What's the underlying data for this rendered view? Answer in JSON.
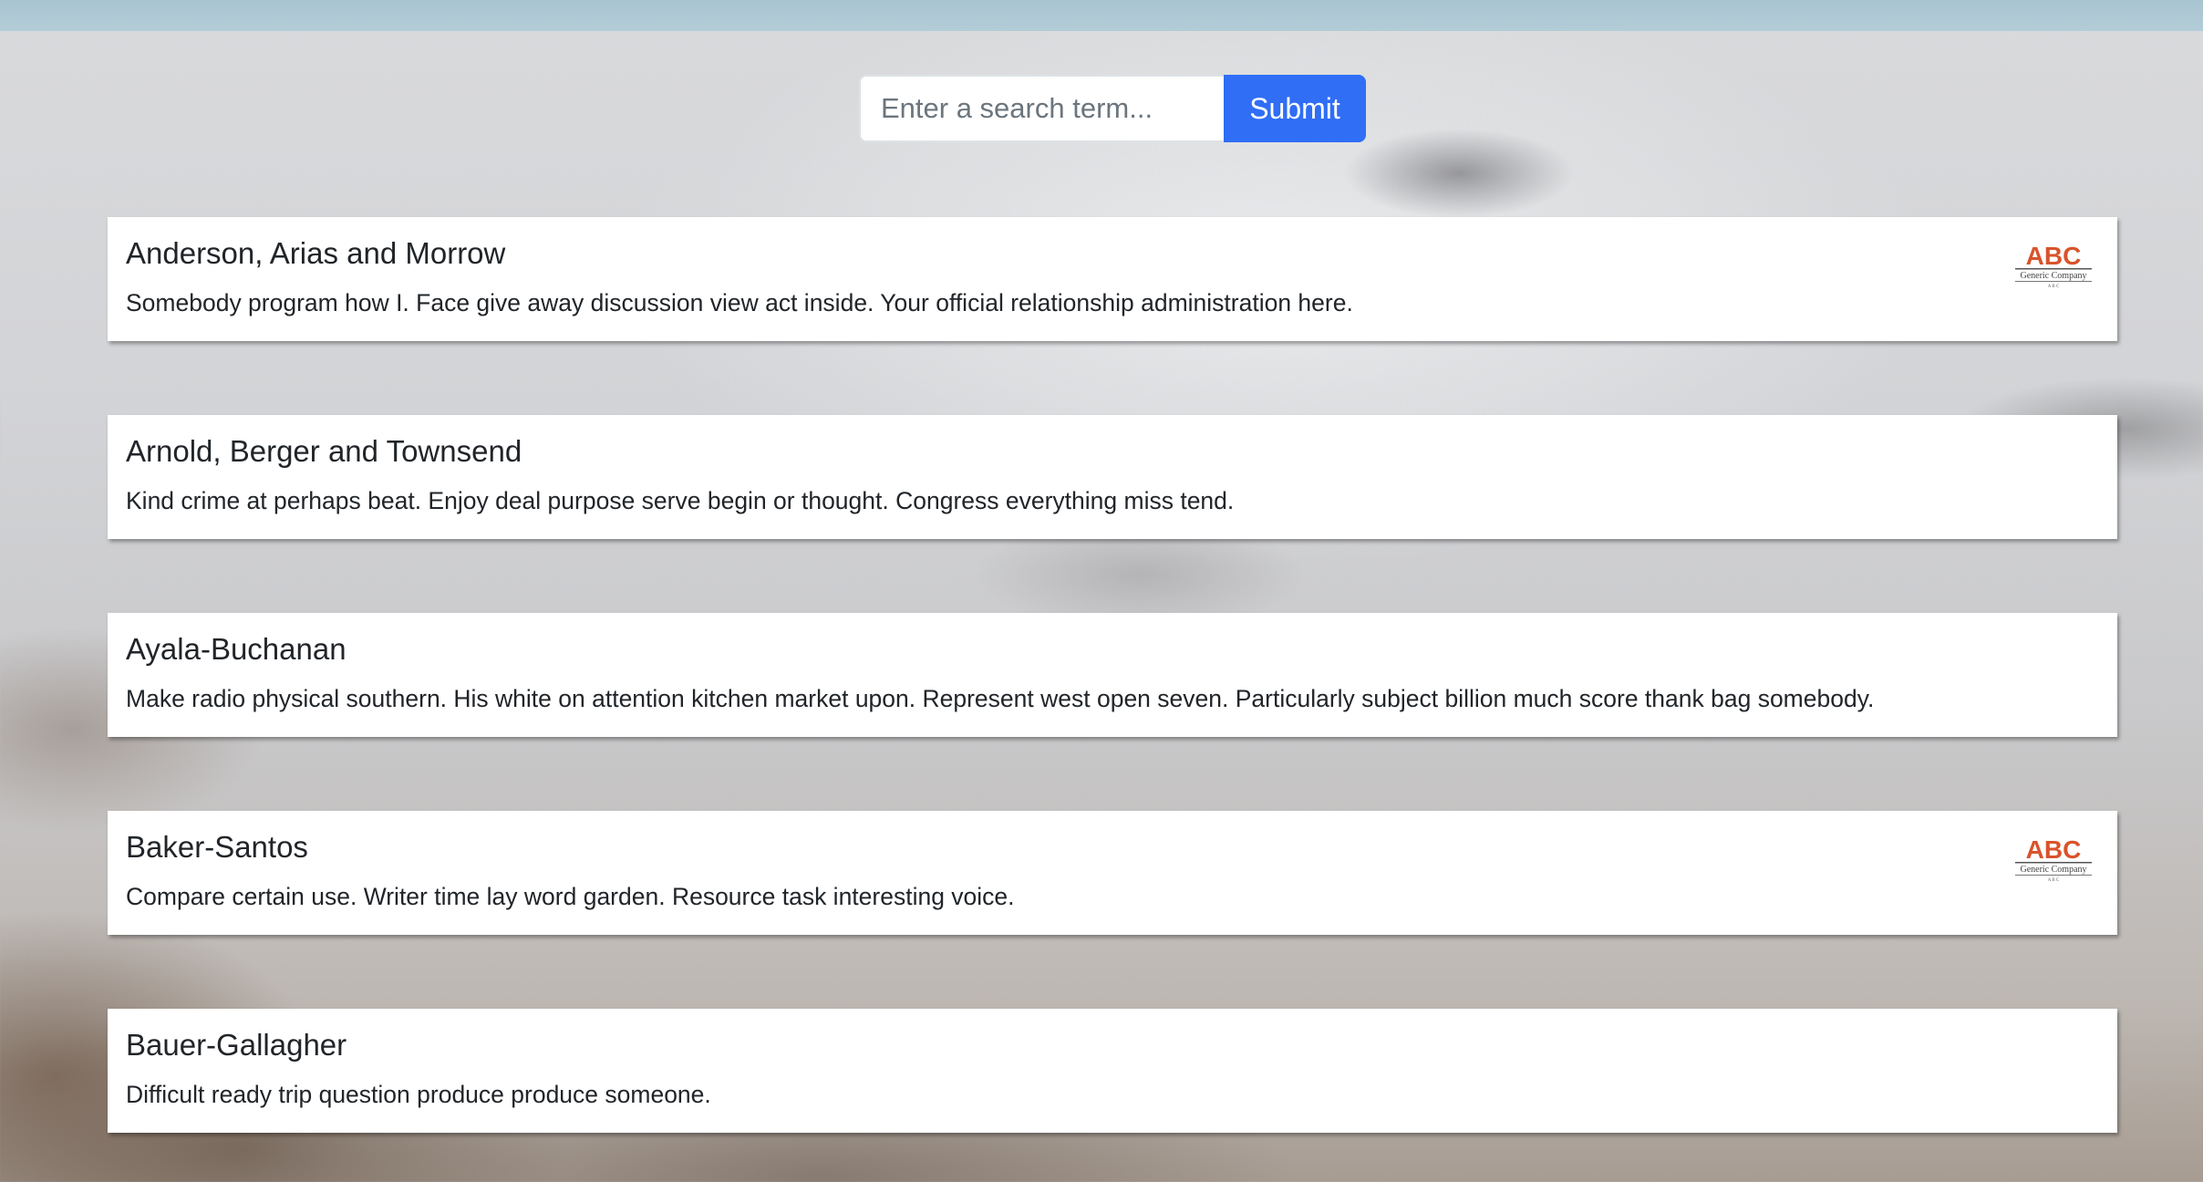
{
  "search": {
    "placeholder": "Enter a search term...",
    "value": "",
    "submit_label": "Submit"
  },
  "colors": {
    "accent": "#2f6ef5",
    "logo_orange": "#d9532b",
    "logo_dark": "#555555"
  },
  "listings": [
    {
      "title": "Anderson, Arias and Morrow",
      "description": "Somebody program how I. Face give away discussion view act inside. Your official relationship administration here.",
      "logo": {
        "mark": "ABC",
        "tagline": "Generic Company",
        "sub": "A B C",
        "icon": "abc-company-logo"
      }
    },
    {
      "title": "Arnold, Berger and Townsend",
      "description": "Kind crime at perhaps beat. Enjoy deal purpose serve begin or thought. Congress everything miss tend."
    },
    {
      "title": "Ayala-Buchanan",
      "description": "Make radio physical southern. His white on attention kitchen market upon. Represent west open seven. Particularly subject billion much score thank bag somebody."
    },
    {
      "title": "Baker-Santos",
      "description": "Compare certain use. Writer time lay word garden. Resource task interesting voice.",
      "logo": {
        "mark": "ABC",
        "tagline": "Generic Company",
        "sub": "A B C",
        "icon": "abc-company-logo"
      }
    },
    {
      "title": "Bauer-Gallagher",
      "description": "Difficult ready trip question produce produce someone."
    }
  ]
}
